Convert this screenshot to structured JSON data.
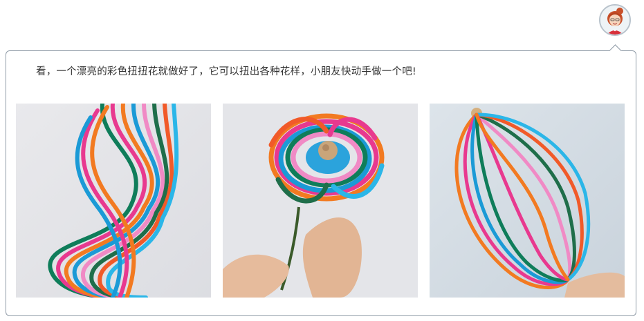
{
  "message": {
    "text": "看，一个漂亮的彩色扭扭花就做好了，它可以扭出各种花样，小朋友快动手做一个吧!"
  },
  "avatar": {
    "icon": "girl-avatar-icon"
  },
  "photos": [
    {
      "icon": "twisted-spiral-paper-flower-icon"
    },
    {
      "icon": "round-paper-flower-on-stem-icon"
    },
    {
      "icon": "oval-lantern-paper-flower-icon"
    }
  ],
  "colors": {
    "strip_colors": [
      "#e8398f",
      "#f27a21",
      "#1b9ad6",
      "#0f7d5a",
      "#f08ac5",
      "#f15a29",
      "#2bb6e8",
      "#1f6e4a"
    ],
    "bubble_border": "#8e9aa6",
    "text": "#333333"
  }
}
